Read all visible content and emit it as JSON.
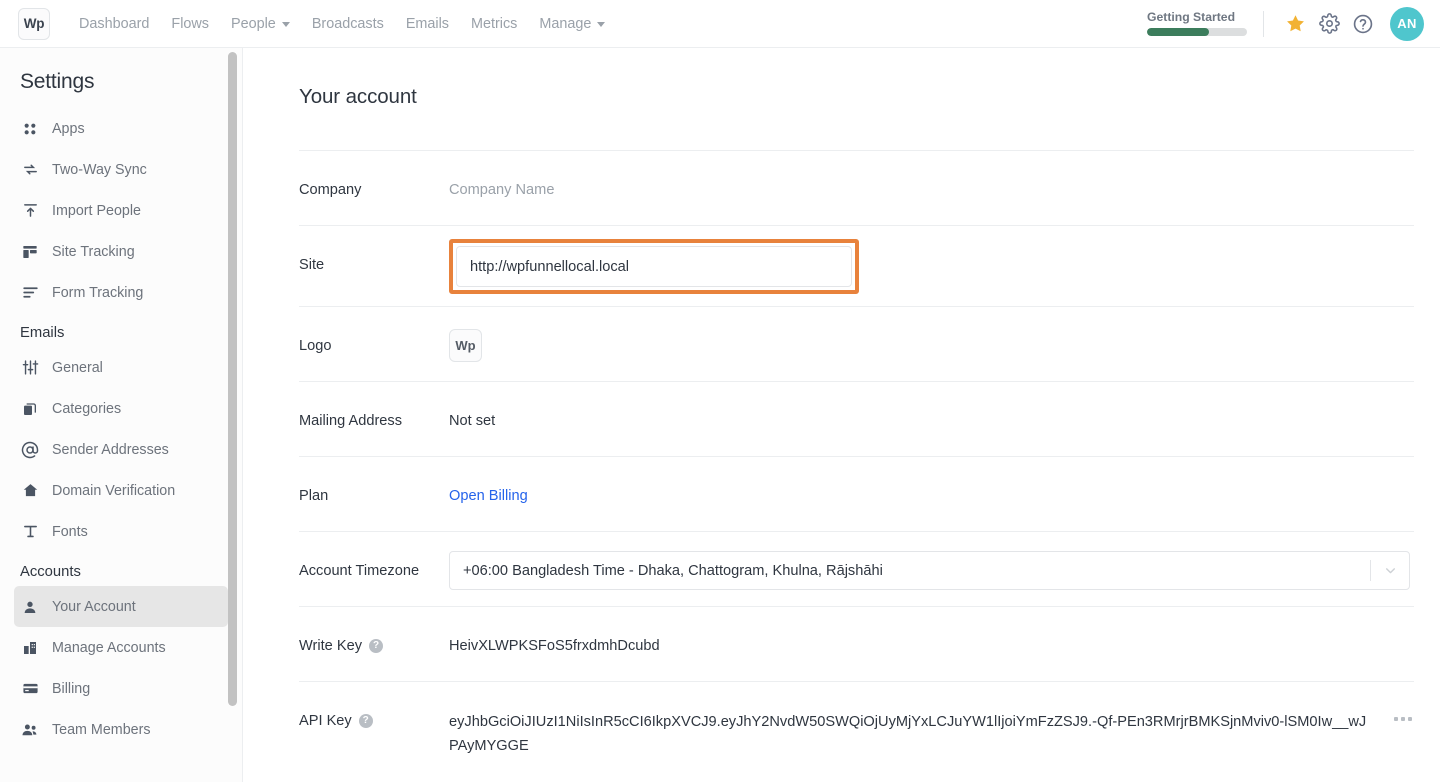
{
  "topnav": {
    "brand": "Wp",
    "items": [
      {
        "label": "Dashboard",
        "caret": false
      },
      {
        "label": "Flows",
        "caret": false
      },
      {
        "label": "People",
        "caret": true
      },
      {
        "label": "Broadcasts",
        "caret": false
      },
      {
        "label": "Emails",
        "caret": false
      },
      {
        "label": "Metrics",
        "caret": false
      },
      {
        "label": "Manage",
        "caret": true
      }
    ],
    "getting_started_label": "Getting Started",
    "getting_started_percent": 62,
    "progress_color": "#3c7d5c",
    "star_icon": "star-icon",
    "gear_icon": "gear-icon",
    "help_icon": "help-circle-icon",
    "avatar_initials": "AN",
    "avatar_color": "#4fc6cd"
  },
  "sidebar": {
    "title": "Settings",
    "items": [
      {
        "label": "Apps",
        "icon": "apps-grid-icon",
        "active": false
      },
      {
        "label": "Two-Way Sync",
        "icon": "sync-arrows-icon",
        "active": false
      },
      {
        "label": "Import People",
        "icon": "import-upload-icon",
        "active": false
      },
      {
        "label": "Site Tracking",
        "icon": "layout-panels-icon",
        "active": false
      },
      {
        "label": "Form Tracking",
        "icon": "form-lines-icon",
        "active": false
      }
    ],
    "group_emails": "Emails",
    "email_items": [
      {
        "label": "General",
        "icon": "sliders-icon",
        "active": false
      },
      {
        "label": "Categories",
        "icon": "copy-stack-icon",
        "active": false
      },
      {
        "label": "Sender Addresses",
        "icon": "at-sign-icon",
        "active": false
      },
      {
        "label": "Domain Verification",
        "icon": "home-icon",
        "active": false
      },
      {
        "label": "Fonts",
        "icon": "text-t-icon",
        "active": false
      }
    ],
    "group_accounts": "Accounts",
    "account_items": [
      {
        "label": "Your Account",
        "icon": "user-icon",
        "active": true
      },
      {
        "label": "Manage Accounts",
        "icon": "building-icon",
        "active": false
      },
      {
        "label": "Billing",
        "icon": "credit-card-icon",
        "active": false
      },
      {
        "label": "Team Members",
        "icon": "users-group-icon",
        "active": false
      }
    ]
  },
  "main": {
    "page_title": "Your account",
    "rows": {
      "company": {
        "label": "Company",
        "value": "Company Name"
      },
      "site": {
        "label": "Site",
        "value": "http://wpfunnellocal.local",
        "highlight_color": "#e8823c"
      },
      "logo": {
        "label": "Logo",
        "value": "Wp"
      },
      "mailing_address": {
        "label": "Mailing Address",
        "value": "Not set"
      },
      "plan": {
        "label": "Plan",
        "link_label": "Open Billing",
        "link_color": "#2563eb"
      },
      "timezone": {
        "label": "Account Timezone",
        "value": "+06:00 Bangladesh Time - Dhaka, Chattogram, Khulna, Rājshāhi"
      },
      "write_key": {
        "label": "Write Key",
        "help": "?",
        "value": "HeivXLWPKSFoS5frxdmhDcubd"
      },
      "api_key": {
        "label": "API Key",
        "help": "?",
        "value": "eyJhbGciOiJIUzI1NiIsInR5cCI6IkpXVCJ9.eyJhY2NvdW50SWQiOjUyMjYxLCJuYW1lIjoiYmFzZSJ9.-Qf-PEn3RMrjrBMKSjnMviv0-lSM0Iw__wJPAyMYGGE",
        "menu_icon": "more-horizontal-icon"
      }
    }
  }
}
